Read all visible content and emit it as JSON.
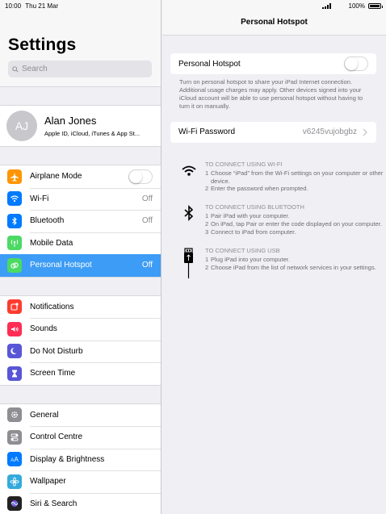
{
  "status": {
    "time": "10:00",
    "date": "Thu 21 Mar",
    "battery": "100%"
  },
  "sidebar": {
    "title": "Settings",
    "search_placeholder": "Search",
    "profile": {
      "initials": "AJ",
      "name": "Alan Jones",
      "subtitle": "Apple ID, iCloud, iTunes & App St..."
    },
    "group1": [
      {
        "label": "Airplane Mode",
        "icon": "airplane-icon",
        "color": "#ff9500",
        "toggle": true
      },
      {
        "label": "Wi-Fi",
        "value": "Off",
        "icon": "wifi-icon",
        "color": "#007aff"
      },
      {
        "label": "Bluetooth",
        "value": "Off",
        "icon": "bluetooth-icon",
        "color": "#007aff"
      },
      {
        "label": "Mobile Data",
        "icon": "antenna-icon",
        "color": "#4cd964"
      },
      {
        "label": "Personal Hotspot",
        "value": "Off",
        "icon": "hotspot-icon",
        "color": "#4cd964",
        "selected": true
      }
    ],
    "group2": [
      {
        "label": "Notifications",
        "icon": "notifications-icon",
        "color": "#ff3b30"
      },
      {
        "label": "Sounds",
        "icon": "sounds-icon",
        "color": "#ff2d55"
      },
      {
        "label": "Do Not Disturb",
        "icon": "moon-icon",
        "color": "#5856d6"
      },
      {
        "label": "Screen Time",
        "icon": "hourglass-icon",
        "color": "#5856d6"
      }
    ],
    "group3": [
      {
        "label": "General",
        "icon": "gear-icon",
        "color": "#8e8e93"
      },
      {
        "label": "Control Centre",
        "icon": "switches-icon",
        "color": "#8e8e93"
      },
      {
        "label": "Display & Brightness",
        "icon": "display-icon",
        "color": "#007aff"
      },
      {
        "label": "Wallpaper",
        "icon": "wallpaper-icon",
        "color": "#34aadc"
      },
      {
        "label": "Siri & Search",
        "icon": "siri-icon",
        "color": "#222"
      }
    ]
  },
  "detail": {
    "title": "Personal Hotspot",
    "hotspot_label": "Personal Hotspot",
    "note": "Turn on personal hotspot to share your iPad Internet connection. Additional usage charges may apply. Other devices signed into your iCloud account will be able to use personal hotspot without having to turn it on manually.",
    "wifi_password_label": "Wi-Fi Password",
    "wifi_password_value": "v6245vujobgbz",
    "wifi": {
      "heading": "TO CONNECT USING WI-FI",
      "steps": [
        "1",
        "Choose “iPad” from the Wi-Fi settings on your computer or other device.",
        "2",
        "Enter the password when prompted."
      ]
    },
    "bt": {
      "heading": "TO CONNECT USING BLUETOOTH",
      "steps": [
        "1",
        "Pair iPad with your computer.",
        "2",
        "On iPad, tap Pair or enter the code displayed on your computer.",
        "3",
        "Connect to iPad from computer."
      ]
    },
    "usb": {
      "heading": "TO CONNECT USING USB",
      "steps": [
        "1",
        "Plug iPad into your computer.",
        "2",
        "Choose iPad from the list of network services in your settings."
      ]
    }
  }
}
